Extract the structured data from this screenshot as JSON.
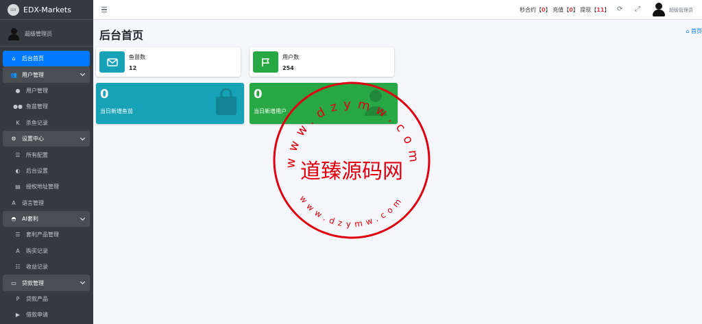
{
  "brand": {
    "logo_text": "EDX",
    "name": "EDX-Markets"
  },
  "user": {
    "name": "超级管理员"
  },
  "sidebar": {
    "items": [
      {
        "label": "后台首页",
        "icon": "home-icon",
        "glyph": "⌂",
        "state": "active",
        "level": 0
      },
      {
        "label": "用户管理",
        "icon": "users-icon",
        "glyph": "👥",
        "state": "open",
        "level": 0,
        "expandable": true
      },
      {
        "label": "用户管理",
        "icon": "user-icon",
        "glyph": "●",
        "level": 1
      },
      {
        "label": "鱼苗管理",
        "icon": "users-icon",
        "glyph": "●●",
        "level": 1
      },
      {
        "label": "杀鱼记录",
        "icon": "k-icon",
        "glyph": "K",
        "level": 1
      },
      {
        "label": "设置中心",
        "icon": "gears-icon",
        "glyph": "⚙",
        "state": "open",
        "level": 0,
        "expandable": true
      },
      {
        "label": "所有配置",
        "icon": "list-icon",
        "glyph": "☰",
        "level": 1
      },
      {
        "label": "后台设置",
        "icon": "adjust-icon",
        "glyph": "◐",
        "level": 1
      },
      {
        "label": "授权地址管理",
        "icon": "file-icon",
        "glyph": "▤",
        "level": 1
      },
      {
        "label": "语言管理",
        "icon": "language-icon",
        "glyph": "A",
        "level": 0
      },
      {
        "label": "AI套利",
        "icon": "android-icon",
        "glyph": "◓",
        "state": "open",
        "level": 0,
        "expandable": true
      },
      {
        "label": "套利产品管理",
        "icon": "bars-icon",
        "glyph": "☰",
        "level": 1
      },
      {
        "label": "购买记录",
        "icon": "a-box-icon",
        "glyph": "A",
        "level": 1
      },
      {
        "label": "收益记录",
        "icon": "list-check-icon",
        "glyph": "☷",
        "level": 1
      },
      {
        "label": "贷款管理",
        "icon": "money-icon",
        "glyph": "▭",
        "state": "open",
        "level": 0,
        "expandable": true
      },
      {
        "label": "贷款产品",
        "icon": "product-icon",
        "glyph": "P",
        "level": 1
      },
      {
        "label": "借款申请",
        "icon": "truck-icon",
        "glyph": "▶",
        "level": 1
      }
    ]
  },
  "topbar": {
    "stats": [
      {
        "label": "秒合约",
        "value": "0"
      },
      {
        "label": "充值",
        "value": "0"
      },
      {
        "label": "提现",
        "value": "11"
      }
    ],
    "user_name": "超级管理员"
  },
  "page": {
    "title": "后台首页",
    "breadcrumb": "首页"
  },
  "info_boxes": [
    {
      "label": "鱼苗数",
      "value": "12",
      "color": "#17a2b8",
      "icon": "envelope-icon"
    },
    {
      "label": "用户数",
      "value": "254",
      "color": "#28a745",
      "icon": "flag-icon"
    }
  ],
  "small_boxes": [
    {
      "value": "0",
      "label": "当日新增鱼苗",
      "color": "#17a2b8",
      "icon": "shopping-bag-icon"
    },
    {
      "value": "0",
      "label": "当日新增用户",
      "color": "#28a745",
      "icon": "user-plus-icon"
    }
  ],
  "watermark": {
    "top_text": "www.dzymw.com",
    "center_text": "道臻源码网",
    "bottom_text": "www.dzymw.com",
    "color": "#e0000f"
  }
}
